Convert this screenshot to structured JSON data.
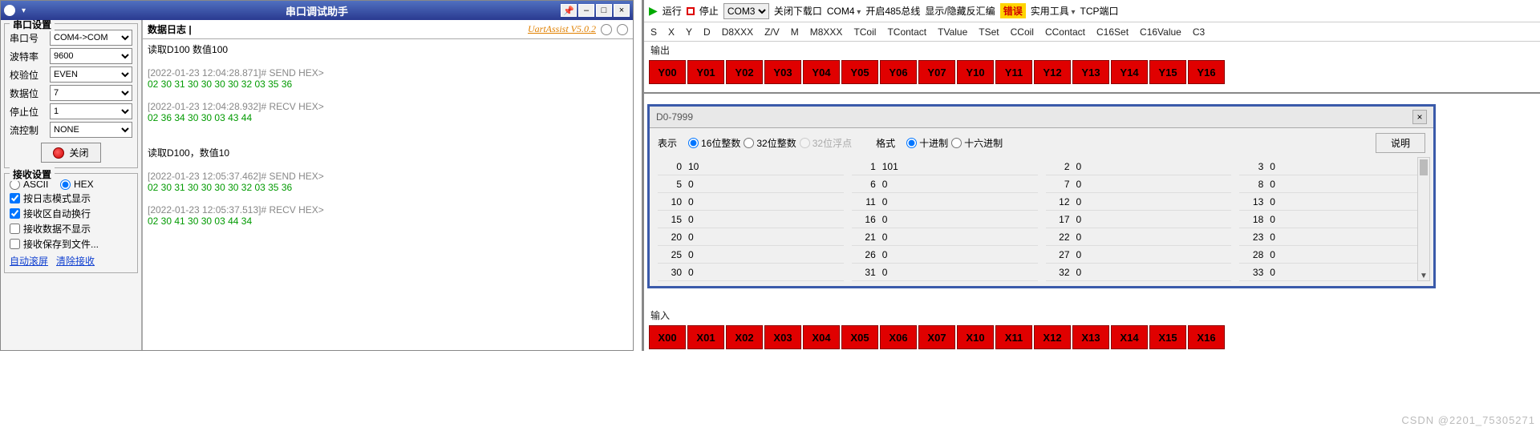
{
  "left": {
    "app_title": "串口调试助手",
    "version_label": "UartAssist V5.0.2",
    "groups": {
      "port": {
        "title": "串口设置",
        "rows": {
          "port": {
            "label": "串口号",
            "value": "COM4->COM"
          },
          "baud": {
            "label": "波特率",
            "value": "9600"
          },
          "parity": {
            "label": "校验位",
            "value": "EVEN"
          },
          "data": {
            "label": "数据位",
            "value": "7"
          },
          "stop": {
            "label": "停止位",
            "value": "1"
          },
          "flow": {
            "label": "流控制",
            "value": "NONE"
          }
        },
        "close_btn": "关闭"
      },
      "recv": {
        "title": "接收设置",
        "mode_ascii": "ASCII",
        "mode_hex": "HEX",
        "chk_logmode": "按日志模式显示",
        "chk_wrap": "接收区自动换行",
        "chk_hide": "接收数据不显示",
        "chk_save": "接收保存到文件...",
        "link_scroll": "自动滚屏",
        "link_clear": "清除接收"
      }
    },
    "log": {
      "head": "数据日志 |",
      "lines": [
        {
          "cls": "black",
          "t": "读取D100 数值100"
        },
        {
          "cls": "",
          "t": ""
        },
        {
          "cls": "gray",
          "t": "[2022-01-23 12:04:28.871]# SEND HEX>"
        },
        {
          "cls": "green",
          "t": "02 30 31 30 30 30 30 32 03 35 36"
        },
        {
          "cls": "",
          "t": ""
        },
        {
          "cls": "gray",
          "t": "[2022-01-23 12:04:28.932]# RECV HEX>"
        },
        {
          "cls": "green",
          "t": "02 36 34 30 30 03 43 44"
        },
        {
          "cls": "",
          "t": ""
        },
        {
          "cls": "",
          "t": ""
        },
        {
          "cls": "black",
          "t": "读取D100，数值10"
        },
        {
          "cls": "",
          "t": ""
        },
        {
          "cls": "gray",
          "t": "[2022-01-23 12:05:37.462]# SEND HEX>"
        },
        {
          "cls": "green",
          "t": "02 30 31 30 30 30 30 32 03 35 36"
        },
        {
          "cls": "",
          "t": ""
        },
        {
          "cls": "gray",
          "t": "[2022-01-23 12:05:37.513]# RECV HEX>"
        },
        {
          "cls": "green",
          "t": "02 30 41 30 30 03 44 34"
        }
      ]
    }
  },
  "right": {
    "toolbar": {
      "run": "运行",
      "stop": "停止",
      "com_a": "COM3",
      "close_dl": "关闭下载口",
      "com_b": "COM4",
      "open485": "开启485总线",
      "toggle_asm": "显示/隐藏反汇编",
      "error": "错误",
      "tools": "实用工具",
      "tcp": "TCP端口"
    },
    "tabs": [
      "S",
      "X",
      "Y",
      "D",
      "D8XXX",
      "Z/V",
      "M",
      "M8XXX",
      "TCoil",
      "TContact",
      "TValue",
      "TSet",
      "CCoil",
      "CContact",
      "C16Set",
      "C16Value",
      "C3"
    ],
    "out_label": "输出",
    "in_label": "输入",
    "y": [
      "Y00",
      "Y01",
      "Y02",
      "Y03",
      "Y04",
      "Y05",
      "Y06",
      "Y07",
      "Y10",
      "Y11",
      "Y12",
      "Y13",
      "Y14",
      "Y15",
      "Y16"
    ],
    "x": [
      "X00",
      "X01",
      "X02",
      "X03",
      "X04",
      "X05",
      "X06",
      "X07",
      "X10",
      "X11",
      "X12",
      "X13",
      "X14",
      "X15",
      "X16"
    ],
    "modal": {
      "title": "D0-7999",
      "repr_label": "表示",
      "fmt_label": "格式",
      "r16": "16位整数",
      "r32": "32位整数",
      "r32f": "32位浮点",
      "dec": "十进制",
      "hex": "十六进制",
      "explain": "说明",
      "cols": [
        [
          {
            "k": "0",
            "v": "10"
          },
          {
            "k": "5",
            "v": "0"
          },
          {
            "k": "10",
            "v": "0"
          },
          {
            "k": "15",
            "v": "0"
          },
          {
            "k": "20",
            "v": "0"
          },
          {
            "k": "25",
            "v": "0"
          },
          {
            "k": "30",
            "v": "0"
          }
        ],
        [
          {
            "k": "1",
            "v": "101"
          },
          {
            "k": "6",
            "v": "0"
          },
          {
            "k": "11",
            "v": "0"
          },
          {
            "k": "16",
            "v": "0"
          },
          {
            "k": "21",
            "v": "0"
          },
          {
            "k": "26",
            "v": "0"
          },
          {
            "k": "31",
            "v": "0"
          }
        ],
        [
          {
            "k": "2",
            "v": "0"
          },
          {
            "k": "7",
            "v": "0"
          },
          {
            "k": "12",
            "v": "0"
          },
          {
            "k": "17",
            "v": "0"
          },
          {
            "k": "22",
            "v": "0"
          },
          {
            "k": "27",
            "v": "0"
          },
          {
            "k": "32",
            "v": "0"
          }
        ],
        [
          {
            "k": "3",
            "v": "0"
          },
          {
            "k": "8",
            "v": "0"
          },
          {
            "k": "13",
            "v": "0"
          },
          {
            "k": "18",
            "v": "0"
          },
          {
            "k": "23",
            "v": "0"
          },
          {
            "k": "28",
            "v": "0"
          },
          {
            "k": "33",
            "v": "0"
          }
        ]
      ]
    }
  },
  "watermark": "CSDN @2201_75305271"
}
